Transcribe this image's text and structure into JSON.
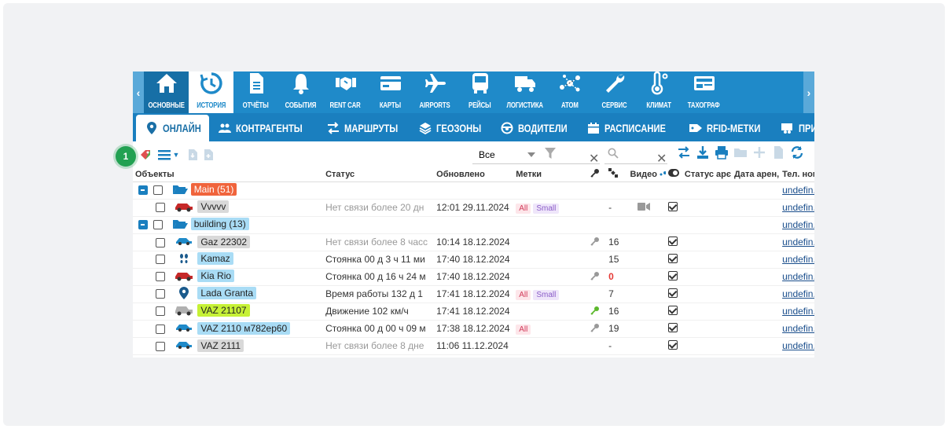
{
  "nav": {
    "items": [
      {
        "label": "ОСНОВНЫЕ",
        "icon": "home-icon",
        "active": true
      },
      {
        "label": "ИСТОРИЯ",
        "icon": "history-icon"
      },
      {
        "label": "ОТЧЁТЫ",
        "icon": "document-icon"
      },
      {
        "label": "СОБЫТИЯ",
        "icon": "bell-icon"
      },
      {
        "label": "RENT CAR",
        "icon": "handshake-icon"
      },
      {
        "label": "КАРТЫ",
        "icon": "card-icon"
      },
      {
        "label": "AIRPORTS",
        "icon": "airplane-icon"
      },
      {
        "label": "РЕЙСЫ",
        "icon": "bus-icon"
      },
      {
        "label": "ЛОГИСТИКА",
        "icon": "truck-icon"
      },
      {
        "label": "ATOM",
        "icon": "molecule-icon"
      },
      {
        "label": "СЕРВИС",
        "icon": "wrench-icon"
      },
      {
        "label": "КЛИМАТ",
        "icon": "thermometer-icon"
      },
      {
        "label": "ТАХОГРАФ",
        "icon": "id-card-icon"
      }
    ]
  },
  "tabs": [
    {
      "label": "ОНЛАЙН",
      "icon": "location-pin-icon",
      "active": true
    },
    {
      "label": "КОНТРАГЕНТЫ",
      "icon": "people-icon"
    },
    {
      "label": "МАРШРУТЫ",
      "icon": "route-icon"
    },
    {
      "label": "ГЕОЗОНЫ",
      "icon": "layers-icon"
    },
    {
      "label": "ВОДИТЕЛИ",
      "icon": "steering-wheel-icon"
    },
    {
      "label": "РАСПИСАНИЕ",
      "icon": "calendar-icon"
    },
    {
      "label": "RFID-МЕТКИ",
      "icon": "tag-icon"
    },
    {
      "label": "ПРИЦЕПЫ",
      "icon": "trailer-icon"
    }
  ],
  "toolbar": {
    "filter_value": "Все",
    "search_placeholder": ""
  },
  "step_badge": "1",
  "columns": [
    "Объекты",
    "Статус",
    "Обновлено",
    "Метки",
    "",
    "",
    "Видео",
    "",
    "Статус арє",
    "Дата арен,",
    "Тел. ном"
  ],
  "rows": [
    {
      "type": "group",
      "indent": 0,
      "name": "Main (51)",
      "name_color": "#f0643c",
      "name_text_color": "#ffffff",
      "phone": "undefin.."
    },
    {
      "type": "item",
      "indent": 1,
      "name": "Vvvvv",
      "name_color": "#d9d9d9",
      "icon": "car-red-icon",
      "status": "Нет связи более 20 дн",
      "status_grey": true,
      "updated": "12:01 29.11.2024",
      "tags": [
        "All",
        "Small"
      ],
      "key": "",
      "sat": "-",
      "video": true,
      "check": true,
      "phone": "undefin.."
    },
    {
      "type": "group",
      "indent": 0,
      "name": "building (13)",
      "name_color": "#a9dcf5",
      "name_text_color": "#222222",
      "phone": "undefin.."
    },
    {
      "type": "item",
      "indent": 2,
      "name": "Gaz 22302",
      "name_color": "#d9d9d9",
      "icon": "car-blue-icon",
      "status": "Нет связи более 8 часс",
      "status_grey": true,
      "updated": "10:14 18.12.2024",
      "tags": [],
      "key": "grey",
      "sat": "16",
      "check": true,
      "phone": "undefin.."
    },
    {
      "type": "item",
      "indent": 2,
      "name": "Kamaz",
      "name_color": "#a9dcf5",
      "icon": "footprints-icon",
      "status": "Стоянка 00 д 3 ч 11 ми",
      "updated": "17:40 18.12.2024",
      "tags": [],
      "key": "",
      "sat": "15",
      "check": true,
      "phone": "undefin.."
    },
    {
      "type": "item",
      "indent": 2,
      "name": "Kia Rio",
      "name_color": "#a9dcf5",
      "icon": "car-red-icon",
      "status": "Стоянка 00 д 16 ч 24 м",
      "updated": "17:40 18.12.2024",
      "tags": [],
      "key": "grey",
      "sat": "0",
      "sat_red": true,
      "check": true,
      "phone": "undefin.."
    },
    {
      "type": "item",
      "indent": 2,
      "name": "Lada Granta",
      "name_color": "#a9dcf5",
      "icon": "pin-icon",
      "status": "Время работы 132 д 1",
      "updated": "17:41 18.12.2024",
      "tags": [
        "All",
        "Small"
      ],
      "key": "",
      "sat": "7",
      "check": true,
      "phone": "undefin.."
    },
    {
      "type": "item",
      "indent": 2,
      "name": "VAZ 21107",
      "name_color": "#c6f135",
      "icon": "car-old-icon",
      "status": "Движение 102 км/ч",
      "updated": "17:41 18.12.2024",
      "tags": [],
      "key": "green",
      "sat": "16",
      "check": true,
      "phone": "undefin.."
    },
    {
      "type": "item",
      "indent": 2,
      "name": "VAZ 2110 м782ер60",
      "name_color": "#a9dcf5",
      "icon": "car-blue-icon",
      "status": "Стоянка 00 д 00 ч 09 м",
      "updated": "17:38 18.12.2024",
      "tags": [
        "All"
      ],
      "key": "grey",
      "sat": "19",
      "check": true,
      "phone": "undefin.."
    },
    {
      "type": "item",
      "indent": 2,
      "name": "VAZ 2111",
      "name_color": "#d9d9d9",
      "icon": "car-blue-icon",
      "status": "Нет связи более 8 дне",
      "status_grey": true,
      "updated": "11:06 11.12.2024",
      "tags": [],
      "key": "",
      "sat": "-",
      "check": true,
      "phone": "undefin.."
    }
  ]
}
